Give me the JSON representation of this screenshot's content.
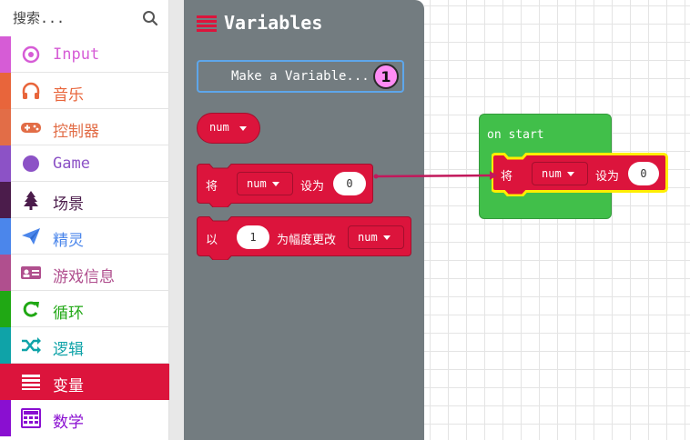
{
  "search": {
    "placeholder": "搜索..."
  },
  "categories": [
    {
      "label": "Input",
      "icon": "target-circle-icon",
      "color": "#d65cd6"
    },
    {
      "label": "音乐",
      "icon": "headphones-icon",
      "color": "#e8653b"
    },
    {
      "label": "控制器",
      "icon": "gamepad-icon",
      "color": "#e26d47"
    },
    {
      "label": "Game",
      "icon": "filled-circle-icon",
      "color": "#8c52c6"
    },
    {
      "label": "场景",
      "icon": "tree-icon",
      "color": "#4b1c4b"
    },
    {
      "label": "精灵",
      "icon": "paper-plane-icon",
      "color": "#4b86eb"
    },
    {
      "label": "游戏信息",
      "icon": "id-card-icon",
      "color": "#b04f8e"
    },
    {
      "label": "循环",
      "icon": "refresh-icon",
      "color": "#20a814"
    },
    {
      "label": "逻辑",
      "icon": "shuffle-icon",
      "color": "#0fa3a8"
    },
    {
      "label": "变量",
      "icon": "list-lines-icon",
      "color": "#dc143c"
    },
    {
      "label": "数学",
      "icon": "calculator-icon",
      "color": "#8a0fd1"
    }
  ],
  "active_category": "变量",
  "flyout": {
    "title": "Variables",
    "make_variable": "Make a Variable...",
    "badge": "1",
    "var_reporter": "num",
    "set_block": {
      "prefix": "将",
      "var": "num",
      "middle": "设为",
      "value": "0"
    },
    "change_block": {
      "prefix": "以",
      "value": "1",
      "middle": "为幅度更改",
      "var": "num"
    }
  },
  "workspace": {
    "on_start": "on start",
    "set_block": {
      "prefix": "将",
      "var": "num",
      "middle": "设为",
      "value": "0"
    }
  },
  "colors": {
    "variables": "#dc143c",
    "loops_green": "#41bf4a",
    "flyout_bg": "#737c80",
    "highlight": "#ffee00",
    "drag_line": "#c2185b"
  }
}
